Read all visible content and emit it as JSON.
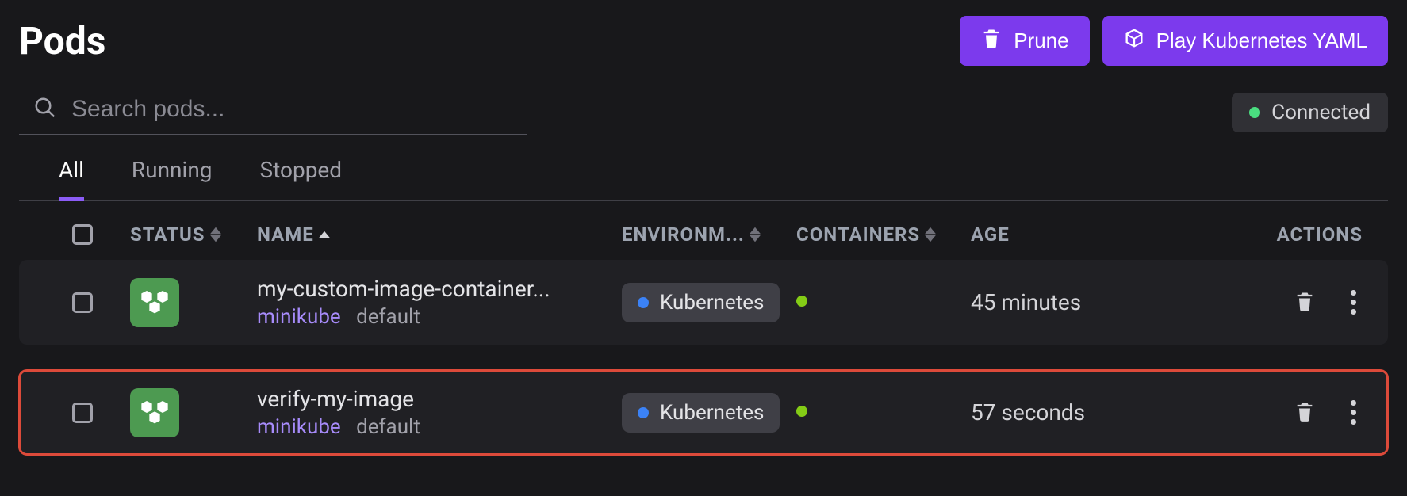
{
  "page_title": "Pods",
  "header": {
    "prune_label": "Prune",
    "play_label": "Play Kubernetes YAML"
  },
  "search": {
    "placeholder": "Search pods..."
  },
  "connection": {
    "label": "Connected",
    "color": "#4ade80"
  },
  "tabs": [
    {
      "label": "All",
      "active": true
    },
    {
      "label": "Running",
      "active": false
    },
    {
      "label": "Stopped",
      "active": false
    }
  ],
  "columns": {
    "status": "STATUS",
    "name": "NAME",
    "environment": "ENVIRONM...",
    "containers": "CONTAINERS",
    "age": "AGE",
    "actions": "ACTIONS"
  },
  "rows": [
    {
      "name": "my-custom-image-container...",
      "cluster": "minikube",
      "namespace": "default",
      "environment": "Kubernetes",
      "container_status": "running",
      "age": "45 minutes",
      "highlighted": false
    },
    {
      "name": "verify-my-image",
      "cluster": "minikube",
      "namespace": "default",
      "environment": "Kubernetes",
      "container_status": "running",
      "age": "57 seconds",
      "highlighted": true
    }
  ]
}
